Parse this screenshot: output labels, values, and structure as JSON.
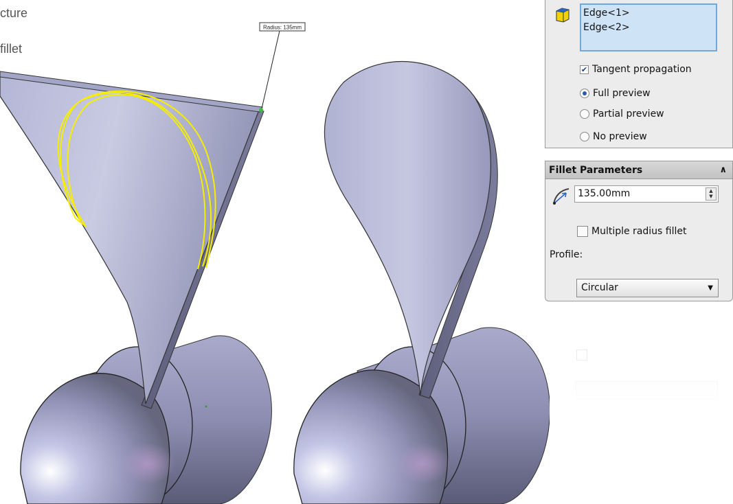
{
  "captions": [
    "cture",
    "fillet"
  ],
  "viewport": {
    "radius_callout": "Radius: 135mm"
  },
  "selection": {
    "items": [
      "Edge<1>",
      "Edge<2>"
    ],
    "tangent_propagation": {
      "label": "Tangent propagation",
      "checked": true
    },
    "preview_options": [
      {
        "label": "Full preview",
        "selected": true
      },
      {
        "label": "Partial preview",
        "selected": false
      },
      {
        "label": "No preview",
        "selected": false
      }
    ]
  },
  "fillet_parameters": {
    "title": "Fillet Parameters",
    "radius_value": "135.00mm",
    "multiple_radius": {
      "label": "Multiple radius fillet",
      "checked": false
    },
    "profile_label": "Profile:",
    "profile_value": "Circular"
  },
  "colors": {
    "selection_highlight": "#f5ee00",
    "model_shade": "#9ea0c2",
    "list_background": "#cfe3f7",
    "list_border": "#6fa8dc"
  }
}
